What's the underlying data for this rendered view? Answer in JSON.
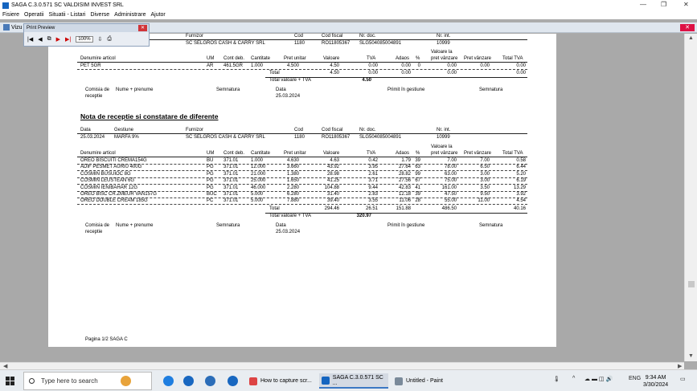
{
  "window": {
    "title": "SAGA C.3.0.571  SC VALDISIM INVEST SRL",
    "min": "—",
    "restore": "❐",
    "close": "✕"
  },
  "menu": [
    "Fisiere",
    "Operatii",
    "Situatii - Listari",
    "Diverse",
    "Administrare",
    "Ajutor"
  ],
  "mdi": {
    "label": "Vizu",
    "close": "✕"
  },
  "print_preview": {
    "title": "Print Preview",
    "zoom": "100%",
    "close": "✕"
  },
  "doc": {
    "top": {
      "hdr": {
        "furnizor": "Furnizor",
        "cod": "Cod",
        "codfiscal": "Cod fiscal",
        "nrdoc": "Nr. doc.",
        "nrint": "Nr. int."
      },
      "row": {
        "furnizor": "SC SELGROS CASH & CARRY SRL",
        "cod": "1180",
        "codfiscal": "RO11805367",
        "nrdoc": "SLG504085004891",
        "nrint": "10999"
      },
      "items": [
        {
          "name": "PET 5GR",
          "um": "AR",
          "cont": "461.5GR",
          "cant": "1.000",
          "pret": "4.500",
          "valoare": "4.50",
          "tva": "0.00",
          "adaos": "0.00",
          "pct": "0",
          "pv": "0.00",
          "pvz": "0.00",
          "totaltva": "0.00"
        }
      ],
      "total": {
        "label": "Total",
        "valoare": "4.50",
        "tva": "0.00",
        "adaos": "0.00",
        "pv": "0.00",
        "totaltva": "0.00"
      },
      "totaltva": {
        "label": "Total valoare + TVA",
        "value": "4.50"
      },
      "sign": {
        "data": "25.03.2024"
      }
    },
    "section_title": "Nota de receptie si constatare de diferente",
    "second": {
      "hdr": {
        "data": "Data",
        "gestiune": "Gestiune",
        "furnizor": "Furnizor",
        "cod": "Cod",
        "codfiscal": "Cod fiscal",
        "nrdoc": "Nr. doc.",
        "nrint": "Nr. int."
      },
      "row": {
        "data": "25.03.2024",
        "gestiune": "MARFA 9%",
        "furnizor": "SC SELGROS CASH & CARRY SRL",
        "cod": "1180",
        "codfiscal": "RO11805367",
        "nrdoc": "SLG504085004891",
        "nrint": "10999"
      },
      "items": [
        {
          "name": "OREO BISCUITI CREMA154G",
          "um": "BU",
          "cont": "371.01",
          "cant": "1.000",
          "pret": "4.630",
          "valoare": "4.63",
          "tva": "0.42",
          "adaos": "1.79",
          "pct": "39",
          "pv": "7.00",
          "pvz": "7.00",
          "totaltva": "0.58"
        },
        {
          "name": "ADIF PESMET AURIU 400G",
          "um": "PG",
          "cont": "371.01",
          "cant": "12.000",
          "pret": "3.660",
          "valoare": "43.92",
          "tva": "3.95",
          "adaos": "27.64",
          "pct": "63",
          "pv": "78.00",
          "pvz": "6.50",
          "totaltva": "6.44"
        },
        {
          "name": "COSMIN BUSUIOC 8G",
          "um": "PG",
          "cont": "371.01",
          "cant": "21.000",
          "pret": "1.380",
          "valoare": "28.98",
          "tva": "2.61",
          "adaos": "28.82",
          "pct": "99",
          "pv": "63.00",
          "pvz": "3.00",
          "totaltva": "5.20"
        },
        {
          "name": "COSMIN LEUSTEAN 6G",
          "um": "PG",
          "cont": "371.01",
          "cant": "25.000",
          "pret": "1.650",
          "valoare": "41.25",
          "tva": "3.71",
          "adaos": "27.56",
          "pct": "67",
          "pv": "75.00",
          "pvz": "3.00",
          "totaltva": "6.19"
        },
        {
          "name": "COSMIN IENIBAHAR 12G",
          "um": "PG",
          "cont": "371.01",
          "cant": "46.000",
          "pret": "2.280",
          "valoare": "104.88",
          "tva": "9.44",
          "adaos": "42.83",
          "pct": "41",
          "pv": "161.00",
          "pvz": "3.50",
          "totaltva": "13.29"
        },
        {
          "name": "OREO BISC CR.ZMEUR VAN157G",
          "um": "BUC",
          "cont": "371.01",
          "cant": "5.000",
          "pret": "6.280",
          "valoare": "31.40",
          "tva": "2.83",
          "adaos": "12.18",
          "pct": "39",
          "pv": "47.50",
          "pvz": "9.50",
          "totaltva": "3.92"
        },
        {
          "name": "OREO DOUBLE CREAM 185G",
          "um": "PC",
          "cont": "371.01",
          "cant": "5.000",
          "pret": "7.880",
          "valoare": "39.40",
          "tva": "3.55",
          "adaos": "11.06",
          "pct": "28",
          "pv": "55.00",
          "pvz": "11.00",
          "totaltva": "4.54"
        }
      ],
      "total": {
        "label": "Total",
        "valoare": "294.46",
        "tva": "26.51",
        "adaos": "151.88",
        "pv": "486.50",
        "totaltva": "40.16"
      },
      "totaltva": {
        "label": "Total valoare + TVA",
        "value": "320.97"
      },
      "sign": {
        "data": "25.03.2024"
      }
    },
    "cols": {
      "den": "Denumire articol",
      "um": "UM",
      "cont": "Cont deb.",
      "cant": "Cantitate",
      "pret": "Pret unitar",
      "valoare": "Valoare",
      "tva": "TVA",
      "adaos": "Adaos",
      "pct": "%",
      "pv1": "Valoare la",
      "pv2": "pret vânzare",
      "pvz": "Pret vânzare",
      "totaltva": "Total TVA"
    },
    "signcols": {
      "comisia1": "Comisia de",
      "comisia2": "receptie",
      "nume": "Nume + prenume",
      "semnatura": "Semnatura",
      "data": "Data",
      "primit": "Primit în gestiune",
      "semnatura2": "Semnatura"
    },
    "footer": "Pagina 1/2  SAGA C"
  },
  "taskbar": {
    "search_placeholder": "Type here to search",
    "tasks": [
      "How to capture scr...",
      "SAGA C.3.0.571  SC ...",
      "Untitled - Paint"
    ],
    "lang": "ENG",
    "time": "9:34 AM",
    "date": "3/30/2024"
  }
}
